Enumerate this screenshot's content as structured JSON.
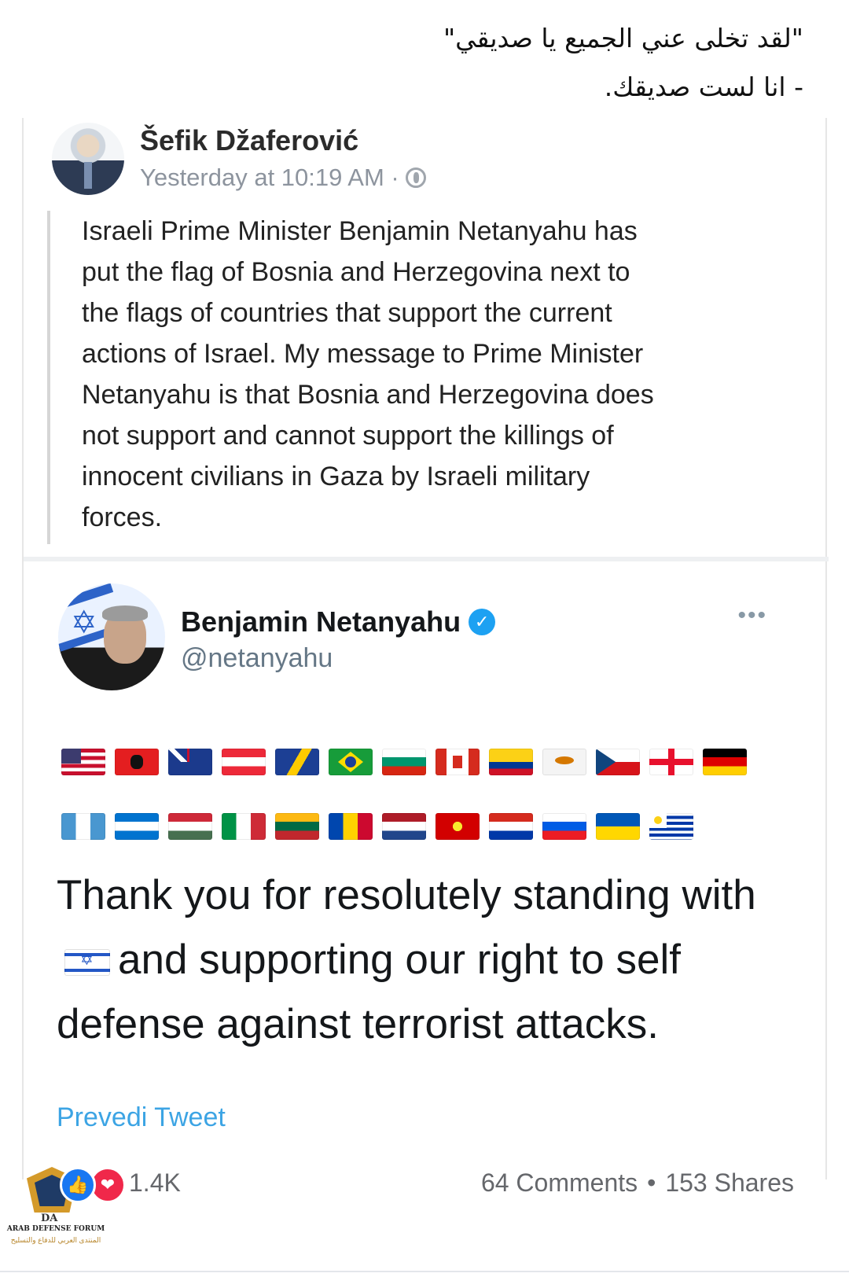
{
  "caption": {
    "line1": "\"لقد تخلى عني الجميع يا صديقي\"",
    "line2": "- انا لست صديقك."
  },
  "fb_post": {
    "author": "Šefik Džaferović",
    "timestamp": "Yesterday at 10:19 AM ·",
    "privacy_icon": "globe-icon",
    "text": "Israeli Prime Minister Benjamin Netanyahu has\nput the flag of Bosnia and Herzegovina next to\nthe flags of countries that support the current\nactions of Israel. My message to Prime Minister\nNetanyahu is that Bosnia and Herzegovina does\nnot support and cannot support the killings of\ninnocent civilians in Gaza by Israeli military\nforces."
  },
  "tweet": {
    "name": "Benjamin Netanyahu",
    "handle": "@netanyahu",
    "verified_mark": "✓",
    "more": "•••",
    "flags_row1": [
      "us",
      "al",
      "au",
      "at",
      "ba",
      "br",
      "bg",
      "ca",
      "co",
      "cy",
      "cz",
      "ge",
      "de"
    ],
    "flags_row2": [
      "gt",
      "hn",
      "hu",
      "it",
      "lt",
      "md",
      "nl",
      "mk",
      "py",
      "si",
      "ua",
      "uy"
    ],
    "text_part1": "Thank you for resolutely standing with",
    "text_part2": "and supporting our right to self defense against terrorist attacks.",
    "translate": "Prevedi Tweet"
  },
  "footer": {
    "logo_abbr": "DA",
    "logo_text": "ARAB DEFENSE FORUM",
    "logo_text_ar": "المنتدى العربي للدفاع والتسليح",
    "like_icon": "👍",
    "love_icon": "❤",
    "reaction_count": "1.4K",
    "comments": "64 Comments",
    "separator": "•",
    "shares": "153 Shares"
  }
}
